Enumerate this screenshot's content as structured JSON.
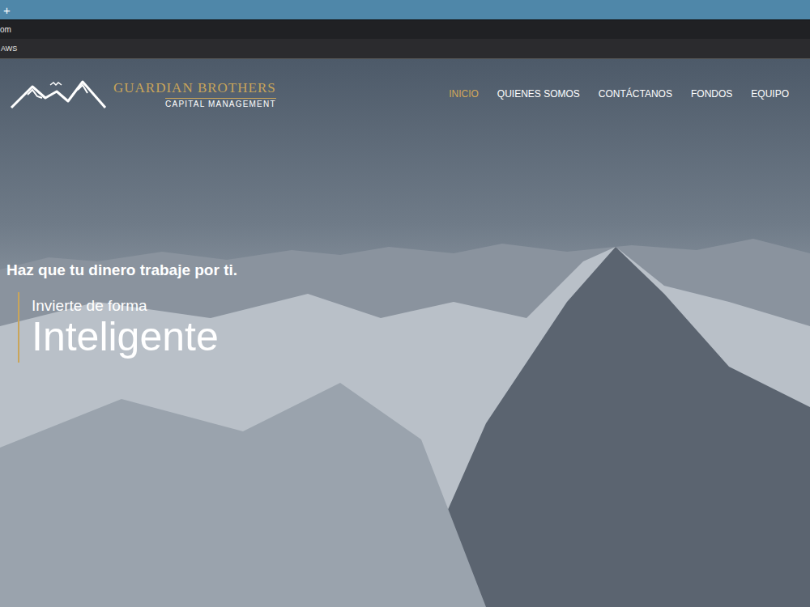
{
  "browser": {
    "new_tab": "+",
    "address": "om",
    "bookmarks": [
      "AWS"
    ]
  },
  "logo": {
    "title": "GUARDIAN BROTHERS",
    "subtitle": "CAPITAL MANAGEMENT"
  },
  "nav": [
    {
      "label": "INICIO",
      "selected": true
    },
    {
      "label": "QUIENES SOMOS",
      "selected": false
    },
    {
      "label": "CONTÁCTANOS",
      "selected": false
    },
    {
      "label": "FONDOS",
      "selected": false
    },
    {
      "label": "EQUIPO",
      "selected": false
    }
  ],
  "hero": {
    "tagline": "Haz que tu dinero trabaje por ti.",
    "lead": "Invierte de forma",
    "headline": "Inteligente"
  }
}
